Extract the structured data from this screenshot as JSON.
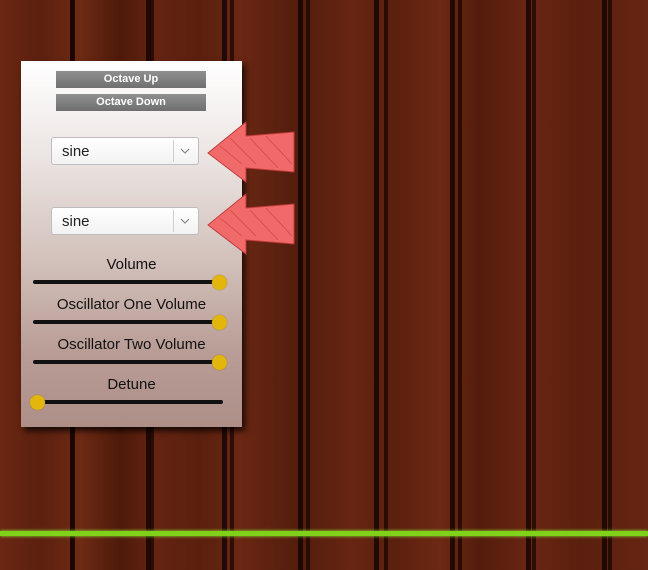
{
  "buttons": {
    "octave_up": "Octave Up",
    "octave_down": "Octave Down"
  },
  "oscillator_one": {
    "selected": "sine"
  },
  "oscillator_two": {
    "selected": "sine"
  },
  "sliders": [
    {
      "label": "Volume",
      "level": 1.0
    },
    {
      "label": "Oscillator One Volume",
      "level": 1.0
    },
    {
      "label": "Oscillator Two Volume",
      "level": 1.0
    },
    {
      "label": "Detune",
      "level": 0.0
    }
  ],
  "colors": {
    "slider_thumb": "#e3b60e",
    "arrow": "#f06a6a",
    "floor_line": "#7fd11a"
  },
  "icons": {
    "dropdown": "chevron-down-icon",
    "pointer": "arrow-left-icon"
  }
}
